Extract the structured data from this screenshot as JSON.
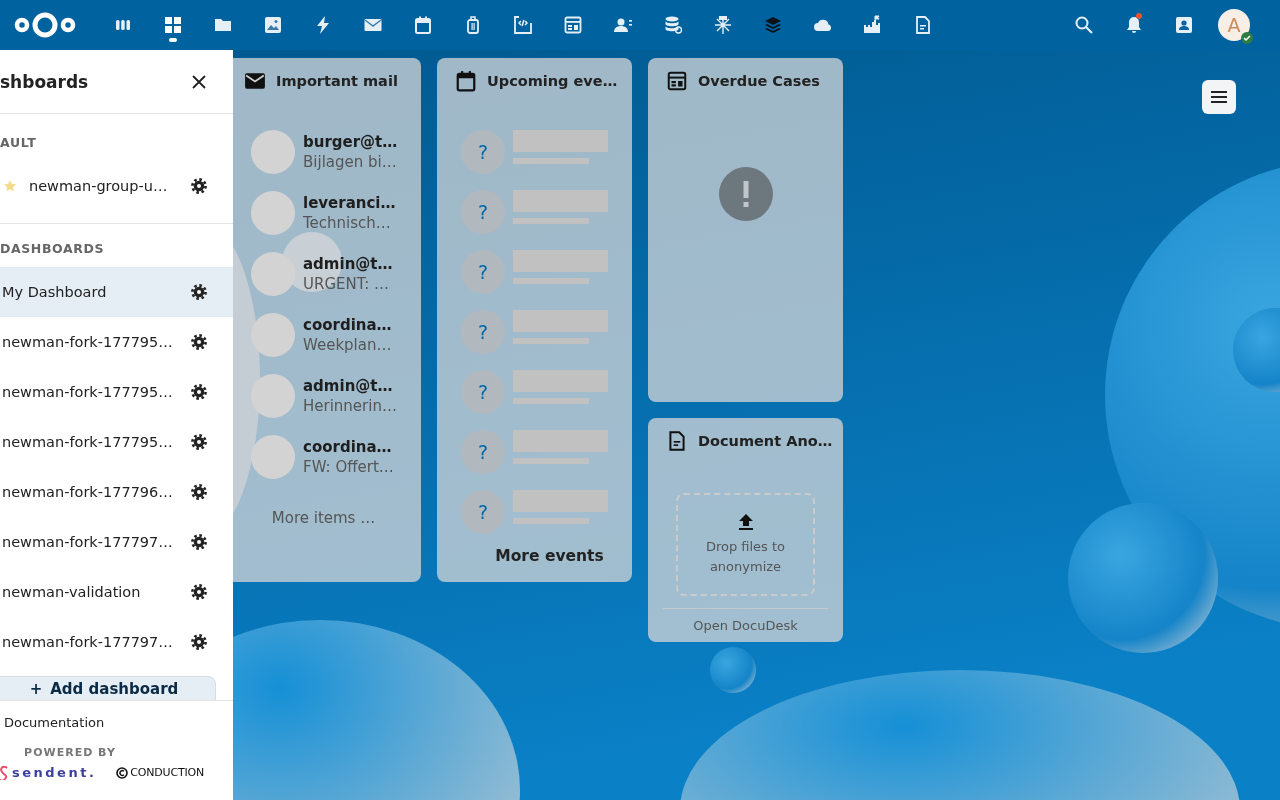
{
  "top_bar": {
    "apps": [
      {
        "kind": "apps",
        "selected": false
      },
      {
        "kind": "dashboard",
        "selected": true
      },
      {
        "kind": "files",
        "selected": false
      },
      {
        "kind": "photos",
        "selected": false
      },
      {
        "kind": "activity",
        "selected": false
      },
      {
        "kind": "mail",
        "selected": false
      },
      {
        "kind": "calendar",
        "selected": false
      },
      {
        "kind": "suitcase",
        "selected": false
      },
      {
        "kind": "code",
        "selected": false
      },
      {
        "kind": "table",
        "selected": false
      },
      {
        "kind": "contacts",
        "selected": false
      },
      {
        "kind": "database",
        "selected": false
      },
      {
        "kind": "snow",
        "selected": false
      },
      {
        "kind": "layers",
        "selected": false
      },
      {
        "kind": "cloud",
        "selected": false
      },
      {
        "kind": "castle",
        "selected": false
      },
      {
        "kind": "document",
        "selected": false
      }
    ],
    "notifications": {
      "unread": true
    },
    "user": {
      "initial": "A",
      "online": true
    }
  },
  "sidebar": {
    "title": "shboards",
    "sections": [
      {
        "label": "AULT",
        "items": [
          {
            "label": "newman-group-u…",
            "default": true,
            "selected": false
          }
        ]
      },
      {
        "label": "DASHBOARDS",
        "items": [
          {
            "label": "My Dashboard",
            "default": false,
            "selected": true
          },
          {
            "label": "newman-fork-177795…",
            "default": false,
            "selected": false
          },
          {
            "label": "newman-fork-177795…",
            "default": false,
            "selected": false
          },
          {
            "label": "newman-fork-177795…",
            "default": false,
            "selected": false
          },
          {
            "label": "newman-fork-177796…",
            "default": false,
            "selected": false
          },
          {
            "label": "newman-fork-177797…",
            "default": false,
            "selected": false
          },
          {
            "label": "newman-validation",
            "default": false,
            "selected": false
          },
          {
            "label": "newman-fork-177797…",
            "default": false,
            "selected": false
          }
        ]
      }
    ],
    "add_button": "Add dashboard",
    "add_icon": "+",
    "documentation": "Documentation",
    "powered_by": "POWERED BY",
    "logos": [
      "sendent.",
      "CONDUCTION"
    ]
  },
  "widgets": {
    "mail": {
      "title": "Important mail",
      "items": [
        {
          "sender": "burger@t…",
          "subject": "Bijlagen bi…"
        },
        {
          "sender": "leveranci…",
          "subject": "Technisch…"
        },
        {
          "sender": "admin@t…",
          "subject": "URGENT: …"
        },
        {
          "sender": "coordina…",
          "subject": "Weekplan…"
        },
        {
          "sender": "admin@t…",
          "subject": "Herinnerin…"
        },
        {
          "sender": "coordina…",
          "subject": "FW: Offert…"
        }
      ],
      "more": "More items …"
    },
    "events": {
      "title": "Upcoming eve…",
      "items": [
        {
          "mark": "?"
        },
        {
          "mark": "?"
        },
        {
          "mark": "?"
        },
        {
          "mark": "?"
        },
        {
          "mark": "?"
        },
        {
          "mark": "?"
        },
        {
          "mark": "?"
        }
      ],
      "more": "More events"
    },
    "overdue": {
      "title": "Overdue Cases"
    },
    "document": {
      "title": "Document Ano…",
      "drop_text": "Drop files to anonymize",
      "link": "Open DocuDesk"
    }
  }
}
